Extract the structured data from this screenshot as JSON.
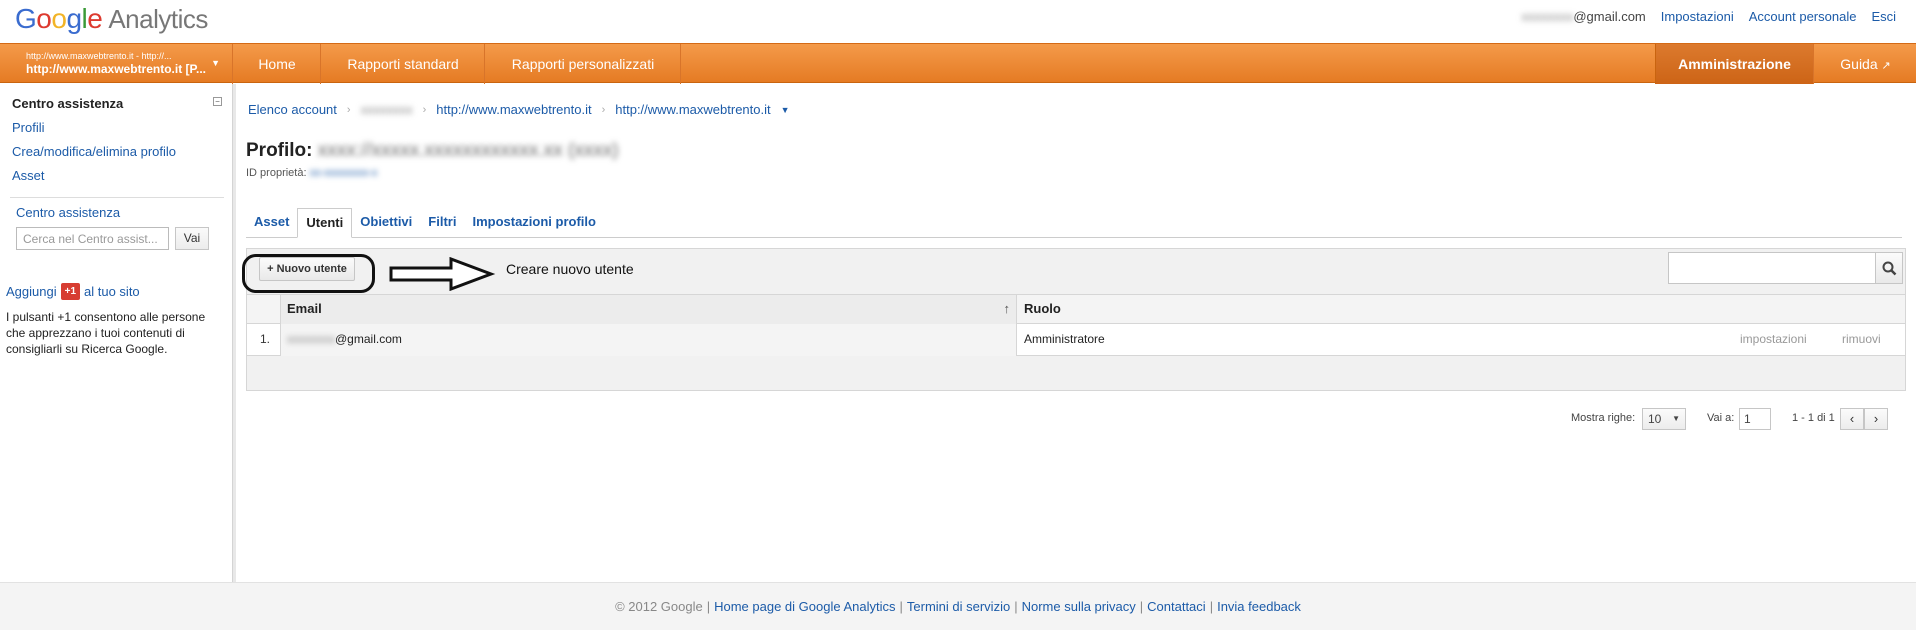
{
  "header": {
    "logo_letters": [
      "G",
      "o",
      "o",
      "g",
      "l",
      "e"
    ],
    "product": "Analytics",
    "email_suffix": "@gmail.com",
    "links": [
      "Impostazioni",
      "Account personale",
      "Esci"
    ]
  },
  "nav": {
    "profile_line1": "http://www.maxwebtrento.it - http://...",
    "profile_line2": "http://www.maxwebtrento.it [P...",
    "items": [
      "Home",
      "Rapporti standard",
      "Rapporti personalizzati"
    ],
    "admin": "Amministrazione",
    "help": "Guida"
  },
  "sidebar": {
    "title": "Centro assistenza",
    "links": [
      "Profili",
      "Crea/modifica/elimina profilo",
      "Asset"
    ],
    "help_link": "Centro assistenza",
    "search_placeholder": "Cerca nel Centro assist...",
    "search_button": "Vai",
    "plus_pre": "Aggiungi",
    "plus_badge": "+1",
    "plus_post": "al tuo sito",
    "plus_text": "I pulsanti +1 consentono alle persone che apprezzano i tuoi contenuti di consigliarli su Ricerca Google."
  },
  "breadcrumb": {
    "items": [
      "Elenco account",
      "http://www.maxwebtrento.it",
      "http://www.maxwebtrento.it"
    ]
  },
  "profile": {
    "label": "Profilo:",
    "prop_label": "ID proprietà:"
  },
  "tabs": [
    "Asset",
    "Utenti",
    "Obiettivi",
    "Filtri",
    "Impostazioni profilo"
  ],
  "panel": {
    "new_user": "+ Nuovo utente",
    "annotation": "Creare nuovo utente"
  },
  "table": {
    "headers": {
      "email": "Email",
      "role": "Ruolo"
    },
    "rows": [
      {
        "num": "1.",
        "email_suffix": "@gmail.com",
        "role": "Amministratore",
        "action1": "impostazioni",
        "action2": "rimuovi"
      }
    ]
  },
  "pager": {
    "rows_label": "Mostra righe:",
    "rows_value": "10",
    "goto_label": "Vai a:",
    "goto_value": "1",
    "range": "1 - 1 di 1"
  },
  "footer": {
    "copyright": "© 2012 Google",
    "links": [
      "Home page di Google Analytics",
      "Termini di servizio",
      "Norme sulla privacy",
      "Contattaci",
      "Invia feedback"
    ]
  }
}
